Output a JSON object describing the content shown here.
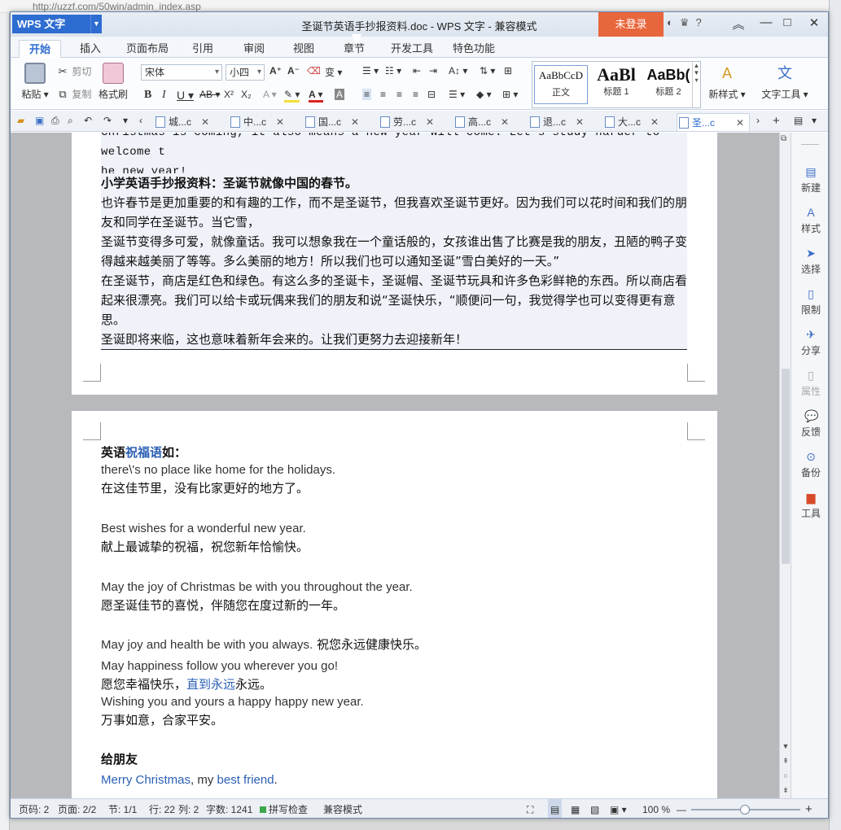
{
  "background": {
    "url_text": "http://uzzf.com/50win/admin_index.asp"
  },
  "app": {
    "logo": "WPS 文字",
    "title": "圣诞节英语手抄报资料.doc - WPS 文字 - 兼容模式",
    "login": "未登录",
    "help": "?"
  },
  "menu_tabs": [
    "开始",
    "插入",
    "页面布局",
    "引用",
    "审阅",
    "视图",
    "章节",
    "开发工具",
    "特色功能"
  ],
  "ribbon": {
    "paste": "粘贴",
    "cut": "剪切",
    "copy": "复制",
    "format_painter": "格式刷",
    "font_name": "宋体",
    "font_size": "小四",
    "styles": [
      {
        "preview": "AaBbCcD",
        "label": "正文"
      },
      {
        "preview": "AaBl",
        "label": "标题 1"
      },
      {
        "preview": "AaBb(",
        "label": "标题 2"
      }
    ],
    "new_style": "新样式",
    "text_tools": "文字工具"
  },
  "doc_tabs": [
    "城...c",
    "中...c",
    "国...c",
    "劳...c",
    "高...c",
    "退...c",
    "大...c",
    "圣...c"
  ],
  "page1": {
    "mono_line1": "Christmas is coming, it also means a new year will come. Let's study harder to welcome t",
    "mono_line2": "he new year!",
    "heading": "小学英语手抄报资料：圣诞节就像中国的春节。",
    "p1": "也许春节是更加重要的和有趣的工作，而不是圣诞节，但我喜欢圣诞节更好。因为我们可以花时间和我们的朋友和同学在圣诞节。当它雪，",
    "p2": "圣诞节变得多可爱，就像童话。我可以想象我在一个童话般的，女孩谁出售了比赛是我的朋友，丑陋的鸭子变得越来越美丽了等等。多么美丽的地方！所以我们也可以通知圣诞”雪白美好的一天。”",
    "p3": "在圣诞节，商店是红色和绿色。有这么多的圣诞卡，圣诞帽、圣诞节玩具和许多色彩鲜艳的东西。所以商店看起来很漂亮。我们可以给卡或玩偶来我们的朋友和说“圣诞快乐，“顺便问一句，我觉得学也可以变得更有意思。",
    "p4": "圣诞即将来临，这也意味着新年会来的。让我们更努力去迎接新年！"
  },
  "page2": {
    "title_pre": "英语",
    "title_link": "祝福语",
    "title_post": "如：",
    "l1_en": "there\\'s no place like home for the holidays.",
    "l1_zh": "在这佳节里，没有比家更好的地方了。",
    "l2_en": "Best wishes for a wonderful new year.",
    "l2_zh": "献上最诚挚的祝福，祝您新年恰愉快。",
    "l3_en": "May the joy of Christmas be with you throughout the year.",
    "l3_zh": "愿圣诞佳节的喜悦，伴随您在度过新的一年。",
    "l4_en": "May joy and health be with you always.",
    "l4_zh": "祝您永远健康快乐。",
    "l5_en": "May happiness follow you wherever you go!",
    "l5_zh_pre": "愿您幸福快乐，",
    "l5_zh_link": "直到永远",
    "l5_zh_post": "永远。",
    "l6_en": "Wishing you and yours a happy happy new year.",
    "l6_zh": "万事如意，合家平安。",
    "friend_heading": "给朋友",
    "f1_link1": "Merry Christmas",
    "f1_mid": ", my ",
    "f1_link2": "best friend",
    "f1_end": "."
  },
  "right_panel": [
    "新建",
    "样式",
    "选择",
    "限制",
    "分享",
    "属性",
    "反馈",
    "备份",
    "工具"
  ],
  "status": {
    "page": "页码: 2",
    "pages": "页面: 2/2",
    "section": "节: 1/1",
    "row": "行: 22",
    "col": "列: 2",
    "words": "字数: 1241",
    "spell": "拼写检查",
    "mode": "兼容模式",
    "zoom": "100 %"
  },
  "colors": {
    "accent": "#2d6cd0",
    "login": "#e8663c",
    "link": "#2b5fb4"
  }
}
